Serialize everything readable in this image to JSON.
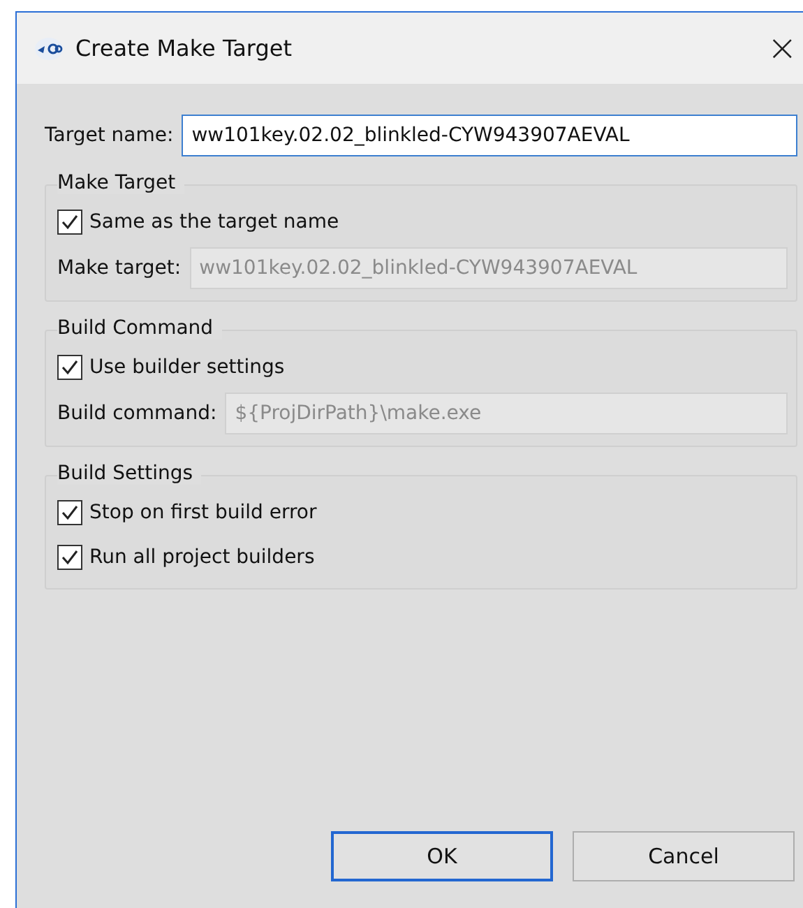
{
  "window": {
    "title": "Create Make Target",
    "close": "×"
  },
  "target_name": {
    "label": "Target name:",
    "value": "ww101key.02.02_blinkled-CYW943907AEVAL",
    "focused": true
  },
  "groups": [
    {
      "title": "Make Target",
      "items": [
        {
          "kind": "checkbox",
          "label": "Same as the target name",
          "checked": true
        },
        {
          "kind": "field",
          "label": "Make target:",
          "value": "ww101key.02.02_blinkled-CYW943907AEVAL",
          "disabled": true
        }
      ]
    },
    {
      "title": "Build Command",
      "items": [
        {
          "kind": "checkbox",
          "label": "Use builder settings",
          "checked": true
        },
        {
          "kind": "field",
          "label": "Build command:",
          "value": "${ProjDirPath}\\make.exe",
          "disabled": true
        }
      ]
    },
    {
      "title": "Build Settings",
      "items": [
        {
          "kind": "checkbox",
          "label": "Stop on first build error",
          "checked": true
        },
        {
          "kind": "checkbox",
          "label": "Run all project builders",
          "checked": true
        }
      ]
    }
  ],
  "buttons": [
    {
      "label": "OK",
      "default": true
    },
    {
      "label": "Cancel",
      "default": false
    }
  ]
}
